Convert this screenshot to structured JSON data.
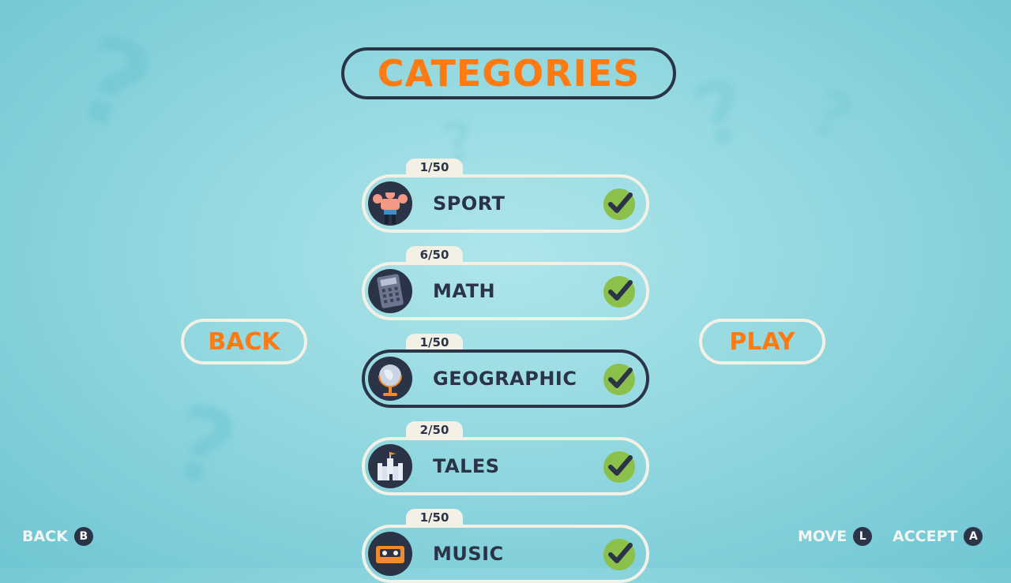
{
  "title": "CATEGORIES",
  "back_button": "BACK",
  "play_button": "PLAY",
  "categories": [
    {
      "count": "1/50",
      "label": "SPORT",
      "icon": "bodybuilder-icon",
      "checked": true
    },
    {
      "count": "6/50",
      "label": "MATH",
      "icon": "calculator-icon",
      "checked": true
    },
    {
      "count": "1/50",
      "label": "GEOGRAPHIC",
      "icon": "globe-icon",
      "checked": true,
      "selected": true
    },
    {
      "count": "2/50",
      "label": "TALES",
      "icon": "castle-icon",
      "checked": true
    },
    {
      "count": "1/50",
      "label": "MUSIC",
      "icon": "cassette-icon",
      "checked": true
    }
  ],
  "hints": {
    "back": {
      "label": "BACK",
      "glyph": "B"
    },
    "move": {
      "label": "MOVE",
      "glyph": "L"
    },
    "accept": {
      "label": "ACCEPT",
      "glyph": "A"
    }
  },
  "colors": {
    "accent": "#ff7a10",
    "dark": "#2b3447",
    "cream": "#f3f1e6",
    "check": "#8bc04a",
    "background": "#93d8e0"
  }
}
